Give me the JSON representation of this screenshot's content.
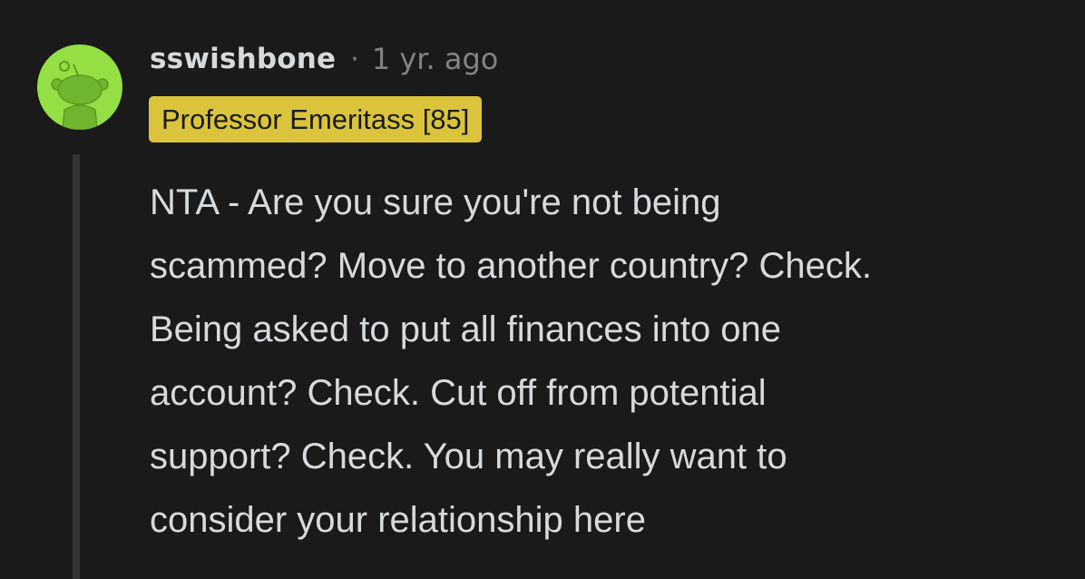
{
  "comment": {
    "author": "sswishbone",
    "separator": "·",
    "timestamp": "1 yr. ago",
    "flair": "Professor Emeritass [85]",
    "avatar_icon": "snoo-avatar-icon",
    "body_lines": [
      "NTA - Are you sure you're not being",
      "scammed? Move to another country? Check.",
      "Being asked to put all finances into one",
      "account? Check. Cut off from potential",
      "support? Check. You may really want to",
      "consider your relationship here"
    ]
  },
  "colors": {
    "background": "#1a1a1b",
    "avatar_bg": "#94e044",
    "flair_bg": "#dbc43c",
    "text": "#d7dadc",
    "muted": "#818384",
    "thread_line": "#343536"
  }
}
